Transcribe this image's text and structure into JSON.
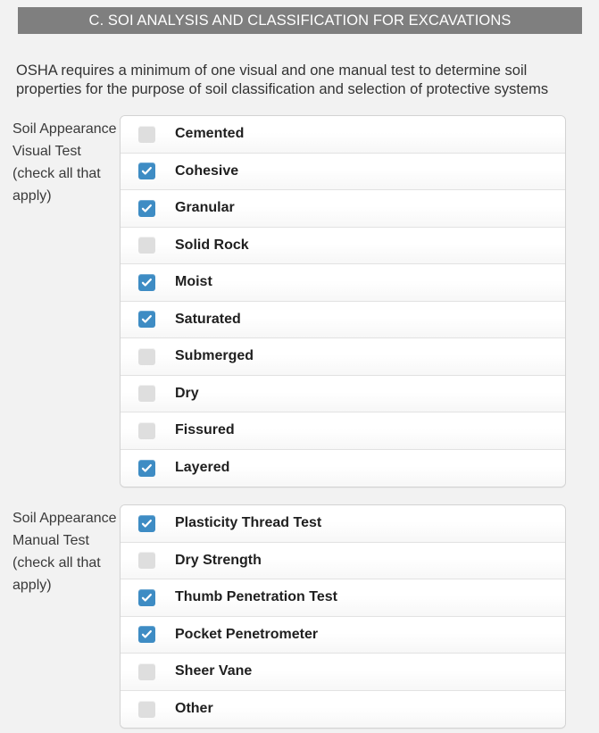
{
  "section": {
    "title": "C. SOI ANALYSIS AND CLASSIFICATION FOR EXCAVATIONS",
    "intro": "OSHA requires a minimum of one visual and one manual test to determine soil properties for the purpose of soil classification and selection of protective systems"
  },
  "colors": {
    "header_bar": "#7f7f7f",
    "checkbox_checked": "#3e8cc4",
    "checkbox_unchecked": "#dedede",
    "page_background": "#f2f2f2",
    "row_border": "#e2e2e2"
  },
  "blocks": [
    {
      "id": "visual",
      "label": "Soil Appearance Visual Test (check all that apply)",
      "items": [
        {
          "label": "Cemented",
          "checked": false,
          "icon": "checkbox-unchecked-icon"
        },
        {
          "label": "Cohesive",
          "checked": true,
          "icon": "checkbox-checked-icon"
        },
        {
          "label": "Granular",
          "checked": true,
          "icon": "checkbox-checked-icon"
        },
        {
          "label": "Solid Rock",
          "checked": false,
          "icon": "checkbox-unchecked-icon"
        },
        {
          "label": "Moist",
          "checked": true,
          "icon": "checkbox-checked-icon"
        },
        {
          "label": "Saturated",
          "checked": true,
          "icon": "checkbox-checked-icon"
        },
        {
          "label": "Submerged",
          "checked": false,
          "icon": "checkbox-unchecked-icon"
        },
        {
          "label": "Dry",
          "checked": false,
          "icon": "checkbox-unchecked-icon"
        },
        {
          "label": "Fissured",
          "checked": false,
          "icon": "checkbox-unchecked-icon"
        },
        {
          "label": "Layered",
          "checked": true,
          "icon": "checkbox-checked-icon"
        }
      ]
    },
    {
      "id": "manual",
      "label": "Soil Appearance Manual Test (check all that apply)",
      "items": [
        {
          "label": "Plasticity Thread Test",
          "checked": true,
          "icon": "checkbox-checked-icon"
        },
        {
          "label": "Dry Strength",
          "checked": false,
          "icon": "checkbox-unchecked-icon"
        },
        {
          "label": "Thumb Penetration Test",
          "checked": true,
          "icon": "checkbox-checked-icon"
        },
        {
          "label": "Pocket Penetrometer",
          "checked": true,
          "icon": "checkbox-checked-icon"
        },
        {
          "label": "Sheer Vane",
          "checked": false,
          "icon": "checkbox-unchecked-icon"
        },
        {
          "label": "Other",
          "checked": false,
          "icon": "checkbox-unchecked-icon"
        }
      ]
    }
  ]
}
